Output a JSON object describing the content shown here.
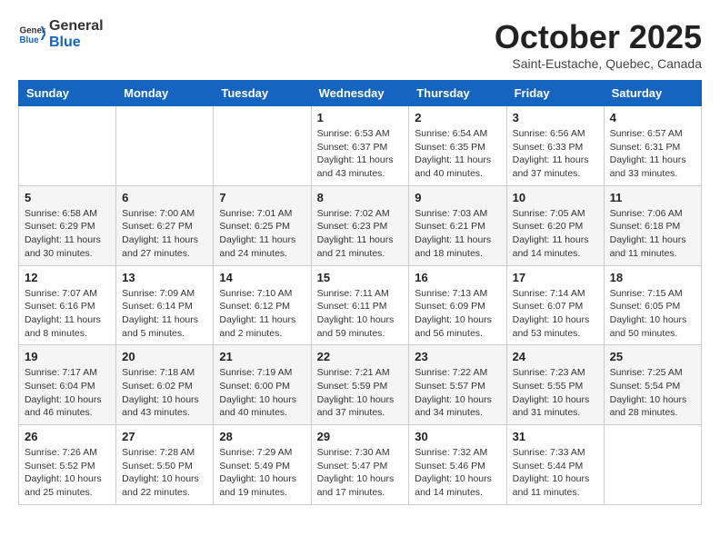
{
  "header": {
    "logo_general": "General",
    "logo_blue": "Blue",
    "month": "October 2025",
    "location": "Saint-Eustache, Quebec, Canada"
  },
  "weekdays": [
    "Sunday",
    "Monday",
    "Tuesday",
    "Wednesday",
    "Thursday",
    "Friday",
    "Saturday"
  ],
  "weeks": [
    [
      {
        "day": null
      },
      {
        "day": null
      },
      {
        "day": null
      },
      {
        "day": 1,
        "sunrise": "Sunrise: 6:53 AM",
        "sunset": "Sunset: 6:37 PM",
        "daylight": "Daylight: 11 hours and 43 minutes."
      },
      {
        "day": 2,
        "sunrise": "Sunrise: 6:54 AM",
        "sunset": "Sunset: 6:35 PM",
        "daylight": "Daylight: 11 hours and 40 minutes."
      },
      {
        "day": 3,
        "sunrise": "Sunrise: 6:56 AM",
        "sunset": "Sunset: 6:33 PM",
        "daylight": "Daylight: 11 hours and 37 minutes."
      },
      {
        "day": 4,
        "sunrise": "Sunrise: 6:57 AM",
        "sunset": "Sunset: 6:31 PM",
        "daylight": "Daylight: 11 hours and 33 minutes."
      }
    ],
    [
      {
        "day": 5,
        "sunrise": "Sunrise: 6:58 AM",
        "sunset": "Sunset: 6:29 PM",
        "daylight": "Daylight: 11 hours and 30 minutes."
      },
      {
        "day": 6,
        "sunrise": "Sunrise: 7:00 AM",
        "sunset": "Sunset: 6:27 PM",
        "daylight": "Daylight: 11 hours and 27 minutes."
      },
      {
        "day": 7,
        "sunrise": "Sunrise: 7:01 AM",
        "sunset": "Sunset: 6:25 PM",
        "daylight": "Daylight: 11 hours and 24 minutes."
      },
      {
        "day": 8,
        "sunrise": "Sunrise: 7:02 AM",
        "sunset": "Sunset: 6:23 PM",
        "daylight": "Daylight: 11 hours and 21 minutes."
      },
      {
        "day": 9,
        "sunrise": "Sunrise: 7:03 AM",
        "sunset": "Sunset: 6:21 PM",
        "daylight": "Daylight: 11 hours and 18 minutes."
      },
      {
        "day": 10,
        "sunrise": "Sunrise: 7:05 AM",
        "sunset": "Sunset: 6:20 PM",
        "daylight": "Daylight: 11 hours and 14 minutes."
      },
      {
        "day": 11,
        "sunrise": "Sunrise: 7:06 AM",
        "sunset": "Sunset: 6:18 PM",
        "daylight": "Daylight: 11 hours and 11 minutes."
      }
    ],
    [
      {
        "day": 12,
        "sunrise": "Sunrise: 7:07 AM",
        "sunset": "Sunset: 6:16 PM",
        "daylight": "Daylight: 11 hours and 8 minutes."
      },
      {
        "day": 13,
        "sunrise": "Sunrise: 7:09 AM",
        "sunset": "Sunset: 6:14 PM",
        "daylight": "Daylight: 11 hours and 5 minutes."
      },
      {
        "day": 14,
        "sunrise": "Sunrise: 7:10 AM",
        "sunset": "Sunset: 6:12 PM",
        "daylight": "Daylight: 11 hours and 2 minutes."
      },
      {
        "day": 15,
        "sunrise": "Sunrise: 7:11 AM",
        "sunset": "Sunset: 6:11 PM",
        "daylight": "Daylight: 10 hours and 59 minutes."
      },
      {
        "day": 16,
        "sunrise": "Sunrise: 7:13 AM",
        "sunset": "Sunset: 6:09 PM",
        "daylight": "Daylight: 10 hours and 56 minutes."
      },
      {
        "day": 17,
        "sunrise": "Sunrise: 7:14 AM",
        "sunset": "Sunset: 6:07 PM",
        "daylight": "Daylight: 10 hours and 53 minutes."
      },
      {
        "day": 18,
        "sunrise": "Sunrise: 7:15 AM",
        "sunset": "Sunset: 6:05 PM",
        "daylight": "Daylight: 10 hours and 50 minutes."
      }
    ],
    [
      {
        "day": 19,
        "sunrise": "Sunrise: 7:17 AM",
        "sunset": "Sunset: 6:04 PM",
        "daylight": "Daylight: 10 hours and 46 minutes."
      },
      {
        "day": 20,
        "sunrise": "Sunrise: 7:18 AM",
        "sunset": "Sunset: 6:02 PM",
        "daylight": "Daylight: 10 hours and 43 minutes."
      },
      {
        "day": 21,
        "sunrise": "Sunrise: 7:19 AM",
        "sunset": "Sunset: 6:00 PM",
        "daylight": "Daylight: 10 hours and 40 minutes."
      },
      {
        "day": 22,
        "sunrise": "Sunrise: 7:21 AM",
        "sunset": "Sunset: 5:59 PM",
        "daylight": "Daylight: 10 hours and 37 minutes."
      },
      {
        "day": 23,
        "sunrise": "Sunrise: 7:22 AM",
        "sunset": "Sunset: 5:57 PM",
        "daylight": "Daylight: 10 hours and 34 minutes."
      },
      {
        "day": 24,
        "sunrise": "Sunrise: 7:23 AM",
        "sunset": "Sunset: 5:55 PM",
        "daylight": "Daylight: 10 hours and 31 minutes."
      },
      {
        "day": 25,
        "sunrise": "Sunrise: 7:25 AM",
        "sunset": "Sunset: 5:54 PM",
        "daylight": "Daylight: 10 hours and 28 minutes."
      }
    ],
    [
      {
        "day": 26,
        "sunrise": "Sunrise: 7:26 AM",
        "sunset": "Sunset: 5:52 PM",
        "daylight": "Daylight: 10 hours and 25 minutes."
      },
      {
        "day": 27,
        "sunrise": "Sunrise: 7:28 AM",
        "sunset": "Sunset: 5:50 PM",
        "daylight": "Daylight: 10 hours and 22 minutes."
      },
      {
        "day": 28,
        "sunrise": "Sunrise: 7:29 AM",
        "sunset": "Sunset: 5:49 PM",
        "daylight": "Daylight: 10 hours and 19 minutes."
      },
      {
        "day": 29,
        "sunrise": "Sunrise: 7:30 AM",
        "sunset": "Sunset: 5:47 PM",
        "daylight": "Daylight: 10 hours and 17 minutes."
      },
      {
        "day": 30,
        "sunrise": "Sunrise: 7:32 AM",
        "sunset": "Sunset: 5:46 PM",
        "daylight": "Daylight: 10 hours and 14 minutes."
      },
      {
        "day": 31,
        "sunrise": "Sunrise: 7:33 AM",
        "sunset": "Sunset: 5:44 PM",
        "daylight": "Daylight: 10 hours and 11 minutes."
      },
      {
        "day": null
      }
    ]
  ]
}
